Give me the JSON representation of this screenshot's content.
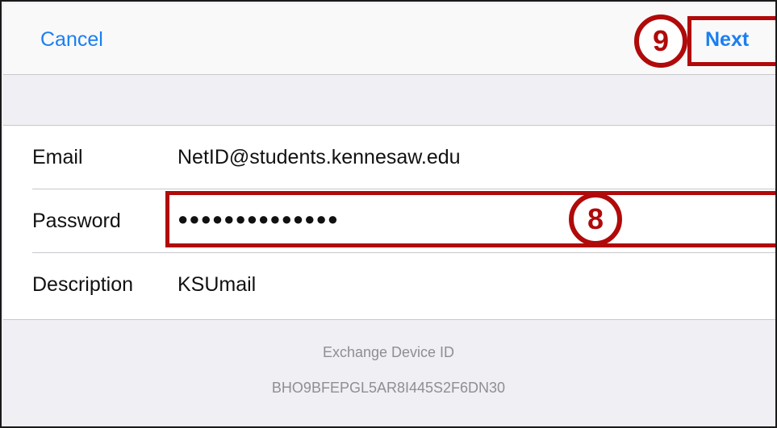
{
  "navbar": {
    "cancel_label": "Cancel",
    "next_label": "Next"
  },
  "annotations": {
    "next_step": "9",
    "password_step": "8"
  },
  "form": {
    "email": {
      "label": "Email",
      "value": "NetID@students.kennesaw.edu"
    },
    "password": {
      "label": "Password",
      "value": "●●●●●●●●●●●●●●"
    },
    "description": {
      "label": "Description",
      "value": "KSUmail"
    }
  },
  "footer": {
    "title": "Exchange Device ID",
    "device_id": "BHO9BFEPGL5AR8I445S2F6DN30"
  },
  "colors": {
    "accent": "#1a7ff0",
    "annotation": "#b00a0a"
  }
}
